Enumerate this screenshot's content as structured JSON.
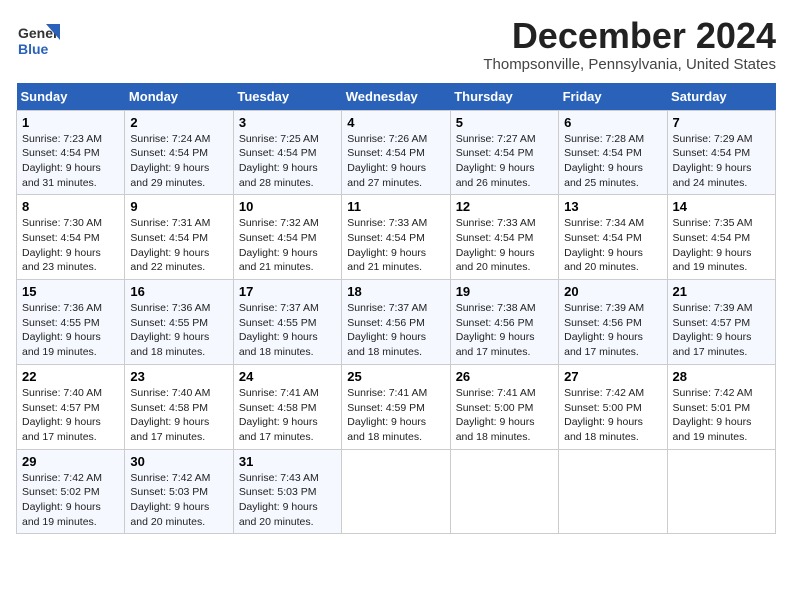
{
  "logo": {
    "general": "General",
    "blue": "Blue"
  },
  "header": {
    "month": "December 2024",
    "location": "Thompsonville, Pennsylvania, United States"
  },
  "weekdays": [
    "Sunday",
    "Monday",
    "Tuesday",
    "Wednesday",
    "Thursday",
    "Friday",
    "Saturday"
  ],
  "weeks": [
    [
      {
        "day": 1,
        "sunrise": "7:23 AM",
        "sunset": "4:54 PM",
        "daylight": "9 hours and 31 minutes."
      },
      {
        "day": 2,
        "sunrise": "7:24 AM",
        "sunset": "4:54 PM",
        "daylight": "9 hours and 29 minutes."
      },
      {
        "day": 3,
        "sunrise": "7:25 AM",
        "sunset": "4:54 PM",
        "daylight": "9 hours and 28 minutes."
      },
      {
        "day": 4,
        "sunrise": "7:26 AM",
        "sunset": "4:54 PM",
        "daylight": "9 hours and 27 minutes."
      },
      {
        "day": 5,
        "sunrise": "7:27 AM",
        "sunset": "4:54 PM",
        "daylight": "9 hours and 26 minutes."
      },
      {
        "day": 6,
        "sunrise": "7:28 AM",
        "sunset": "4:54 PM",
        "daylight": "9 hours and 25 minutes."
      },
      {
        "day": 7,
        "sunrise": "7:29 AM",
        "sunset": "4:54 PM",
        "daylight": "9 hours and 24 minutes."
      }
    ],
    [
      {
        "day": 8,
        "sunrise": "7:30 AM",
        "sunset": "4:54 PM",
        "daylight": "9 hours and 23 minutes."
      },
      {
        "day": 9,
        "sunrise": "7:31 AM",
        "sunset": "4:54 PM",
        "daylight": "9 hours and 22 minutes."
      },
      {
        "day": 10,
        "sunrise": "7:32 AM",
        "sunset": "4:54 PM",
        "daylight": "9 hours and 21 minutes."
      },
      {
        "day": 11,
        "sunrise": "7:33 AM",
        "sunset": "4:54 PM",
        "daylight": "9 hours and 21 minutes."
      },
      {
        "day": 12,
        "sunrise": "7:33 AM",
        "sunset": "4:54 PM",
        "daylight": "9 hours and 20 minutes."
      },
      {
        "day": 13,
        "sunrise": "7:34 AM",
        "sunset": "4:54 PM",
        "daylight": "9 hours and 20 minutes."
      },
      {
        "day": 14,
        "sunrise": "7:35 AM",
        "sunset": "4:54 PM",
        "daylight": "9 hours and 19 minutes."
      }
    ],
    [
      {
        "day": 15,
        "sunrise": "7:36 AM",
        "sunset": "4:55 PM",
        "daylight": "9 hours and 19 minutes."
      },
      {
        "day": 16,
        "sunrise": "7:36 AM",
        "sunset": "4:55 PM",
        "daylight": "9 hours and 18 minutes."
      },
      {
        "day": 17,
        "sunrise": "7:37 AM",
        "sunset": "4:55 PM",
        "daylight": "9 hours and 18 minutes."
      },
      {
        "day": 18,
        "sunrise": "7:37 AM",
        "sunset": "4:56 PM",
        "daylight": "9 hours and 18 minutes."
      },
      {
        "day": 19,
        "sunrise": "7:38 AM",
        "sunset": "4:56 PM",
        "daylight": "9 hours and 17 minutes."
      },
      {
        "day": 20,
        "sunrise": "7:39 AM",
        "sunset": "4:56 PM",
        "daylight": "9 hours and 17 minutes."
      },
      {
        "day": 21,
        "sunrise": "7:39 AM",
        "sunset": "4:57 PM",
        "daylight": "9 hours and 17 minutes."
      }
    ],
    [
      {
        "day": 22,
        "sunrise": "7:40 AM",
        "sunset": "4:57 PM",
        "daylight": "9 hours and 17 minutes."
      },
      {
        "day": 23,
        "sunrise": "7:40 AM",
        "sunset": "4:58 PM",
        "daylight": "9 hours and 17 minutes."
      },
      {
        "day": 24,
        "sunrise": "7:41 AM",
        "sunset": "4:58 PM",
        "daylight": "9 hours and 17 minutes."
      },
      {
        "day": 25,
        "sunrise": "7:41 AM",
        "sunset": "4:59 PM",
        "daylight": "9 hours and 18 minutes."
      },
      {
        "day": 26,
        "sunrise": "7:41 AM",
        "sunset": "5:00 PM",
        "daylight": "9 hours and 18 minutes."
      },
      {
        "day": 27,
        "sunrise": "7:42 AM",
        "sunset": "5:00 PM",
        "daylight": "9 hours and 18 minutes."
      },
      {
        "day": 28,
        "sunrise": "7:42 AM",
        "sunset": "5:01 PM",
        "daylight": "9 hours and 19 minutes."
      }
    ],
    [
      {
        "day": 29,
        "sunrise": "7:42 AM",
        "sunset": "5:02 PM",
        "daylight": "9 hours and 19 minutes."
      },
      {
        "day": 30,
        "sunrise": "7:42 AM",
        "sunset": "5:03 PM",
        "daylight": "9 hours and 20 minutes."
      },
      {
        "day": 31,
        "sunrise": "7:43 AM",
        "sunset": "5:03 PM",
        "daylight": "9 hours and 20 minutes."
      },
      null,
      null,
      null,
      null
    ]
  ]
}
